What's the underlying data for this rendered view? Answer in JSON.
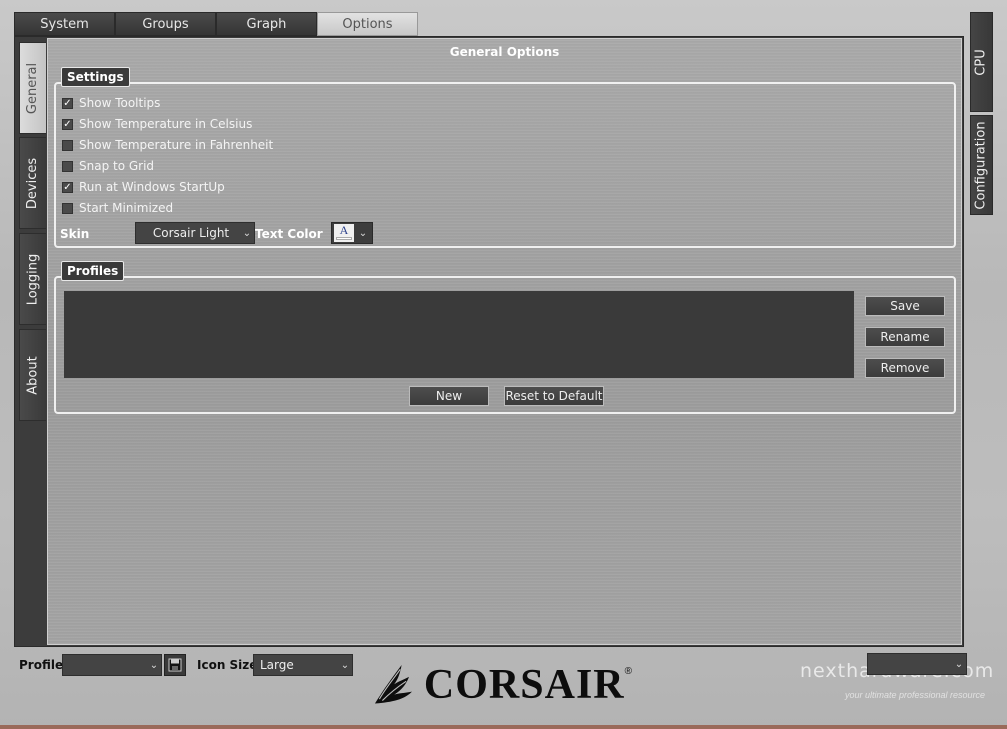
{
  "top_tabs": [
    {
      "label": "System"
    },
    {
      "label": "Groups"
    },
    {
      "label": "Graph"
    },
    {
      "label": "Options",
      "active": true
    }
  ],
  "left_tabs": [
    {
      "label": "General",
      "active": true
    },
    {
      "label": "Devices"
    },
    {
      "label": "Logging"
    },
    {
      "label": "About"
    }
  ],
  "right_tabs": [
    {
      "label": "CPU"
    },
    {
      "label": "Configuration"
    }
  ],
  "page_title": "General Options",
  "settings": {
    "legend": "Settings",
    "checkboxes": [
      {
        "label": "Show Tooltips",
        "checked": true
      },
      {
        "label": "Show Temperature in Celsius",
        "checked": true
      },
      {
        "label": "Show Temperature in Fahrenheit",
        "checked": false
      },
      {
        "label": "Snap to Grid",
        "checked": false
      },
      {
        "label": "Run at Windows StartUp",
        "checked": true
      },
      {
        "label": "Start Minimized",
        "checked": false
      }
    ],
    "skin_label": "Skin",
    "skin_value": "Corsair Light",
    "text_color_label": "Text Color",
    "text_color_glyph": "A"
  },
  "profiles": {
    "legend": "Profiles",
    "save_label": "Save",
    "rename_label": "Rename",
    "remove_label": "Remove",
    "new_label": "New",
    "reset_label": "Reset to Default"
  },
  "bottom": {
    "profile_label": "Profile :",
    "profile_value": "",
    "icon_size_label": "Icon Size :",
    "icon_size_value": "Large",
    "right_dropdown_value": "",
    "logo_text": "CORSAIR",
    "logo_reg": "®"
  },
  "watermark": {
    "text": "nexthardware.com",
    "subtext": "your ultimate professional resource"
  },
  "colors": {
    "panel_dark": "#3c3c3c",
    "brushed_metal": "#a9a9a9",
    "active_tab": "#d0d0d0",
    "text_light": "#f4f4f4"
  }
}
